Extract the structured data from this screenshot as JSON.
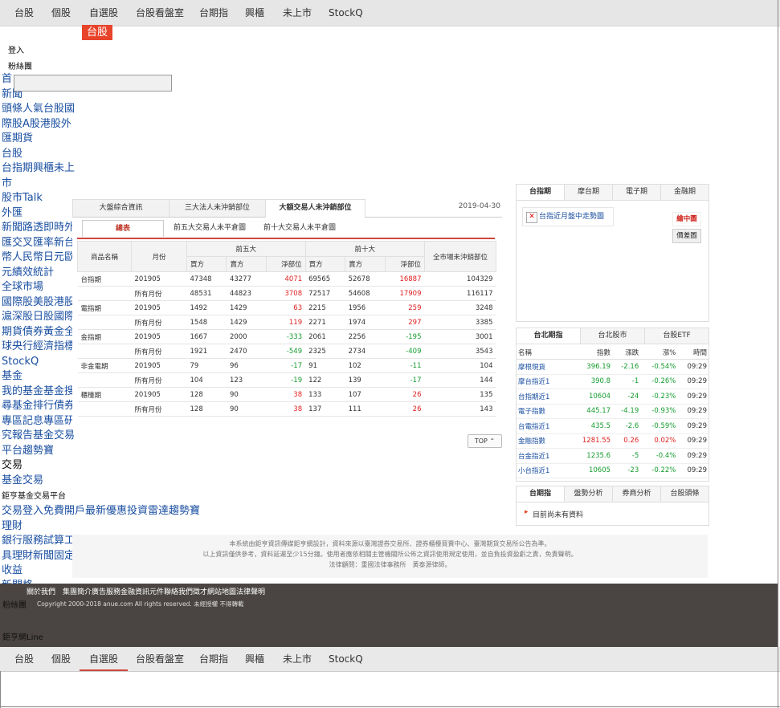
{
  "nav": {
    "items": [
      "台股",
      "個股",
      "自選股",
      "台股看盤室",
      "台期指",
      "興櫃",
      "未上市",
      "StockQ"
    ],
    "active_top": "",
    "badge": "台股"
  },
  "account": {
    "login": "登入",
    "fans": "粉絲團"
  },
  "sidebar": {
    "lines": [
      "首",
      "新聞",
      "頭條人氣台股國",
      "際股A股港股外",
      "匯期貨",
      "台股",
      "台指期興櫃未上",
      "市",
      "股市Talk",
      "外匯",
      "新聞路透即時外",
      "匯交叉匯率新台",
      "幣人民幣日元歐",
      "元績效統計",
      "全球市場",
      "國際股美股港股",
      "滬深股日股國際",
      "期貨債券黃金全",
      "球央行經濟指標",
      "StockQ",
      "基金",
      "我的基金基金搜",
      "尋基金排行債券",
      "專區記息專區研",
      "究報告基金交易",
      "平台趨勢寶",
      "交易",
      "基金交易"
    ],
    "platform_label": "鉅亨基金交易平台",
    "lines2": [
      "交易登入免費開戶最新優惠投資雷達趨勢寶",
      "理財",
      "銀行服務試算工",
      "具理財新聞固定",
      "收益",
      "新聞格"
    ]
  },
  "panel": {
    "tabs": [
      "大盤綜合資訊",
      "三大法人未沖銷部位",
      "大額交易人未沖銷部位"
    ],
    "date": "2019-04-30",
    "subtabs": [
      "總表",
      "前五大交易人未平倉圖",
      "前十大交易人未平倉圖"
    ],
    "headers": {
      "product": "商品名稱",
      "month": "月份",
      "top5": "前五大",
      "top10": "前十大",
      "market": "全市場未沖銷部位",
      "buy": "買方",
      "sell": "賣方",
      "net": "淨部位",
      "net2": "淨部位"
    },
    "rows": [
      {
        "product": "台指期",
        "month": "201905",
        "b5": "47348",
        "s5": "43277",
        "n5": "4071",
        "b10": "69565",
        "s10": "52678",
        "n10": "16887",
        "all": "104329"
      },
      {
        "product": "",
        "month": "所有月份",
        "b5": "48531",
        "s5": "44823",
        "n5": "3708",
        "b10": "72517",
        "s10": "54608",
        "n10": "17909",
        "all": "116117"
      },
      {
        "product": "電指期",
        "month": "201905",
        "b5": "1492",
        "s5": "1429",
        "n5": "63",
        "b10": "2215",
        "s10": "1956",
        "n10": "259",
        "all": "3248"
      },
      {
        "product": "",
        "month": "所有月份",
        "b5": "1548",
        "s5": "1429",
        "n5": "119",
        "b10": "2271",
        "s10": "1974",
        "n10": "297",
        "all": "3385"
      },
      {
        "product": "金指期",
        "month": "201905",
        "b5": "1667",
        "s5": "2000",
        "n5": "-333",
        "b10": "2061",
        "s10": "2256",
        "n10": "-195",
        "all": "3001"
      },
      {
        "product": "",
        "month": "所有月份",
        "b5": "1921",
        "s5": "2470",
        "n5": "-549",
        "b10": "2325",
        "s10": "2734",
        "n10": "-409",
        "all": "3543"
      },
      {
        "product": "非金電期",
        "month": "201905",
        "b5": "79",
        "s5": "96",
        "n5": "-17",
        "b10": "91",
        "s10": "102",
        "n10": "-11",
        "all": "104"
      },
      {
        "product": "",
        "month": "所有月份",
        "b5": "104",
        "s5": "123",
        "n5": "-19",
        "b10": "122",
        "s10": "139",
        "n10": "-17",
        "all": "144"
      },
      {
        "product": "櫃檯期",
        "month": "201905",
        "b5": "128",
        "s5": "90",
        "n5": "38",
        "b10": "133",
        "s10": "107",
        "n10": "26",
        "all": "135"
      },
      {
        "product": "",
        "month": "所有月份",
        "b5": "128",
        "s5": "90",
        "n5": "38",
        "b10": "137",
        "s10": "111",
        "n10": "26",
        "all": "143"
      }
    ],
    "top_button": "TOP ⌃"
  },
  "futures_box": {
    "tabs": [
      "台指期",
      "摩台期",
      "電子期",
      "金融期"
    ],
    "chart_alt": "台指近月盤中走勢圖",
    "btn_red": "繪中圖",
    "btn_gray": "價差圖"
  },
  "quotes": {
    "tabs": [
      "台北期指",
      "台北股市",
      "台股ETF"
    ],
    "headers": [
      "名稱",
      "指數",
      "漲跌",
      "漲%",
      "時間"
    ],
    "rows": [
      {
        "name": "摩根現貨",
        "idx": "396.19",
        "chg": "-2.16",
        "pct": "-0.54%",
        "time": "09:29",
        "dir": "down"
      },
      {
        "name": "摩台指近1",
        "idx": "390.8",
        "chg": "-1",
        "pct": "-0.26%",
        "time": "09:29",
        "dir": "down"
      },
      {
        "name": "台指期近1",
        "idx": "10604",
        "chg": "-24",
        "pct": "-0.23%",
        "time": "09:29",
        "dir": "down"
      },
      {
        "name": "電子指數",
        "idx": "445.17",
        "chg": "-4.19",
        "pct": "-0.93%",
        "time": "09:29",
        "dir": "down"
      },
      {
        "name": "台電指近1",
        "idx": "435.5",
        "chg": "-2.6",
        "pct": "-0.59%",
        "time": "09:29",
        "dir": "down"
      },
      {
        "name": "金融指數",
        "idx": "1281.55",
        "chg": "0.26",
        "pct": "0.02%",
        "time": "09:29",
        "dir": "up"
      },
      {
        "name": "台金指近1",
        "idx": "1235.6",
        "chg": "-5",
        "pct": "-0.4%",
        "time": "09:29",
        "dir": "down"
      },
      {
        "name": "小台指近1",
        "idx": "10605",
        "chg": "-23",
        "pct": "-0.22%",
        "time": "09:29",
        "dir": "down"
      }
    ]
  },
  "analysis": {
    "tabs": [
      "台期指",
      "盤勢分析",
      "券商分析",
      "台股頭條"
    ],
    "empty": "目前尚未有資料"
  },
  "disclaimer": [
    "本系統由鉅亨資訊傳媒鉅亨網設計，資料來源以臺灣證券交易所、證券櫃檯買賣中心、臺灣期貨交易所公告為準。",
    "以上資訊僅供參考，資料延遲至少15分鐘。使用者應依相關主管機關所公佈之資訊使用規定使用，並自負投資盈虧之責，免責聲明。",
    "法律顧問：重國法律事務所　黃泰源律師。"
  ],
  "footer": {
    "links": "關於我們　集團簡介廣告服務金融資訊元件聯絡我們徵才網站地圖法律聲明",
    "copy": "Copyright 2000-2018 anue.com All rights reserved. 未經授權 不得轉載",
    "overlay1": "粉絲團",
    "overlay2": "鉅亨網Line"
  },
  "colors": {
    "accent": "#d0453a",
    "badge": "#e8442b",
    "up": "#e02020",
    "down": "#149c2e",
    "link": "#1a4fa1"
  }
}
